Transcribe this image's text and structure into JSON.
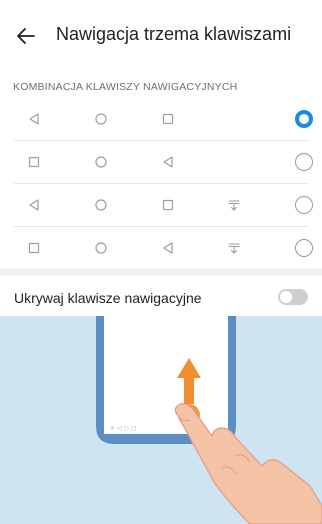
{
  "header": {
    "title": "Nawigacja trzema klawiszami",
    "back_icon": "arrow-left-icon"
  },
  "combinations": {
    "section_label": "KOMBINACJA KLAWISZY NAWIGACYJNYCH",
    "rows": [
      {
        "keys": [
          "back-triangle-icon",
          "home-circle-icon",
          "recents-square-icon"
        ],
        "selected": true
      },
      {
        "keys": [
          "recents-square-icon",
          "home-circle-icon",
          "back-triangle-icon"
        ],
        "selected": false
      },
      {
        "keys": [
          "back-triangle-icon",
          "home-circle-icon",
          "recents-square-icon",
          "notification-pull-down-icon"
        ],
        "selected": false
      },
      {
        "keys": [
          "recents-square-icon",
          "home-circle-icon",
          "back-triangle-icon",
          "notification-pull-down-icon"
        ],
        "selected": false
      }
    ]
  },
  "hide_keys": {
    "label": "Ukrywaj klawisze nawigacyjne",
    "enabled": false
  },
  "illustration": {
    "description_icon": "swipe-up-gesture-illustration",
    "colors": {
      "background": "#cfe4f3",
      "phone_frame": "#5b8fc4",
      "arrow": "#f08d2c",
      "finger": "#f4c3a6"
    }
  },
  "colors": {
    "accent": "#1a8ae8",
    "icon_gray": "#9e9e9e"
  }
}
